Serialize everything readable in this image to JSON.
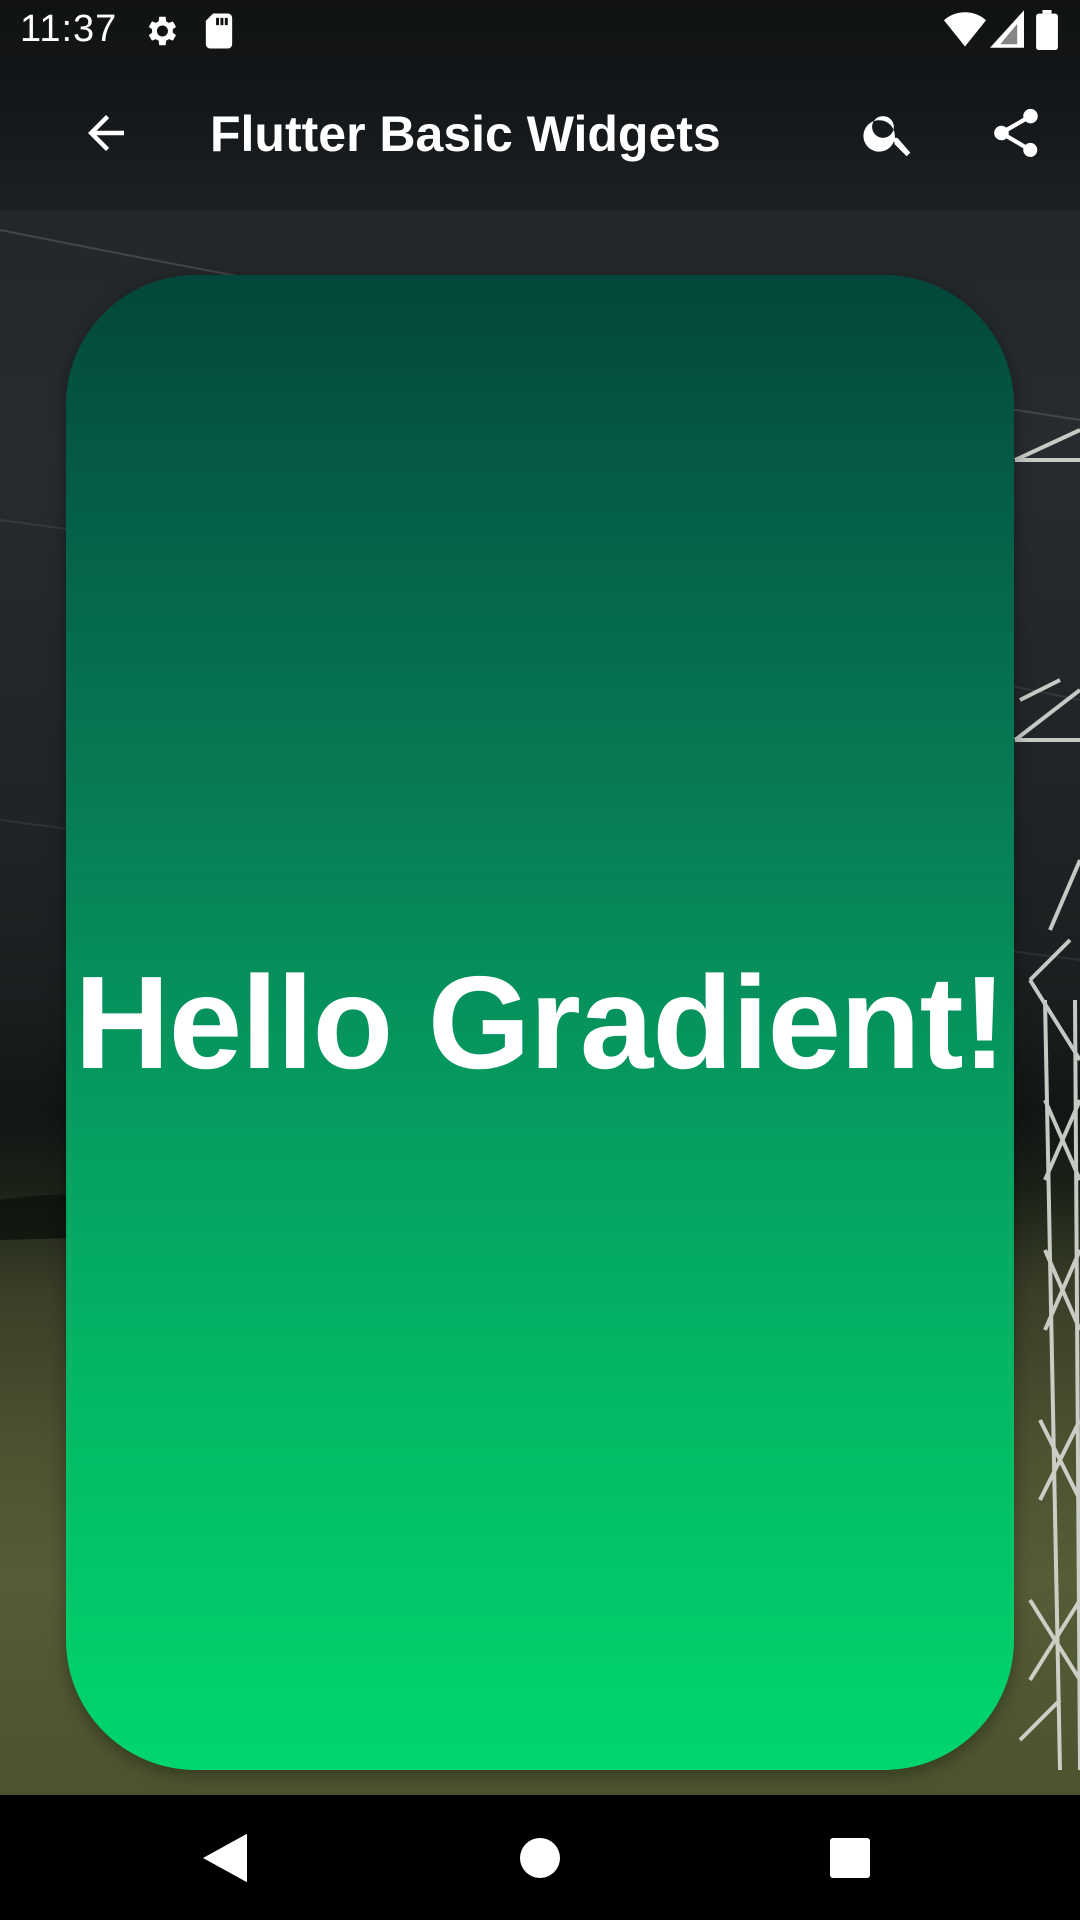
{
  "status_bar": {
    "time": "11:37",
    "left_icons": [
      "settings-icon",
      "sd-card-icon"
    ],
    "right_icons": [
      "wifi-icon",
      "cell-signal-icon",
      "battery-icon"
    ]
  },
  "app_bar": {
    "title": "Flutter Basic Widgets",
    "back_icon": "arrow-back-icon",
    "actions": [
      "search-icon",
      "share-icon"
    ]
  },
  "card": {
    "text": "Hello Gradient!",
    "gradient_start": "#03473a",
    "gradient_end": "#00d66f"
  },
  "nav_bar": {
    "buttons": [
      "back-triangle-icon",
      "home-circle-icon",
      "recents-square-icon"
    ]
  },
  "colors": {
    "text_primary": "#ffffff",
    "nav_background": "#000000"
  }
}
